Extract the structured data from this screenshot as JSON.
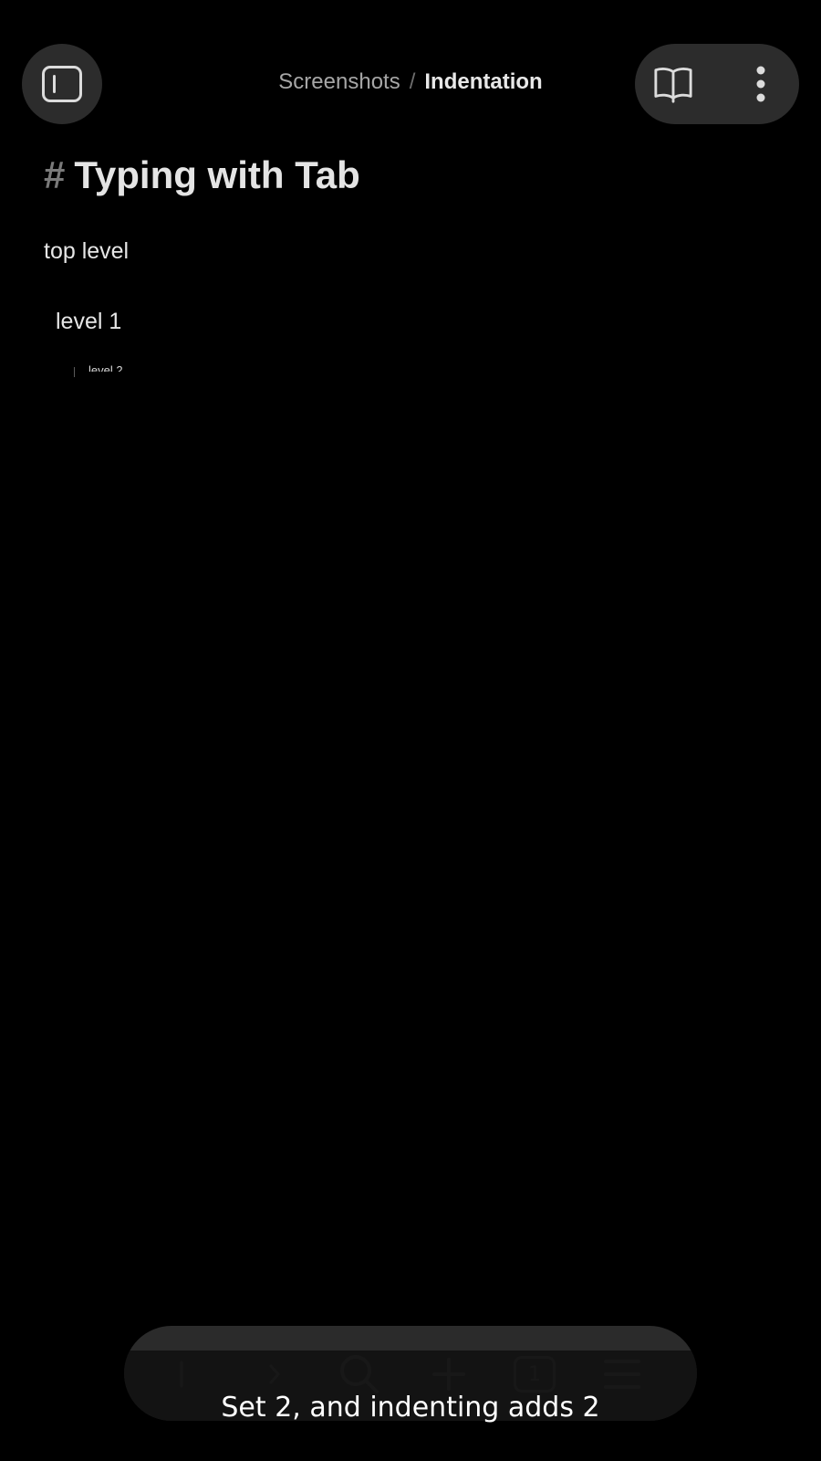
{
  "header": {
    "breadcrumb_parent": "Screenshots",
    "breadcrumb_separator": "/",
    "breadcrumb_current": "Indentation",
    "sidebar_icon": "sidebar-toggle-icon",
    "reading_icon": "open-book-icon",
    "more_icon": "vertical-dots-icon"
  },
  "document": {
    "heading_marker": "#",
    "heading": "Typing with Tab",
    "lines": [
      {
        "text": "top level"
      },
      {
        "text": "level 1"
      },
      {
        "text": "level 2"
      }
    ]
  },
  "toolbar": {
    "tab_count": "1",
    "icons": [
      "back-arrow-icon",
      "forward-arrow-icon",
      "search-icon",
      "plus-icon",
      "tabs-icon",
      "hamburger-menu-icon"
    ]
  },
  "caption": "Set 2, and indenting adds 2",
  "colors": {
    "background": "#000000",
    "surface": "#2c2c2c",
    "text": "#e6e6e6",
    "muted": "#a6a6a6"
  }
}
